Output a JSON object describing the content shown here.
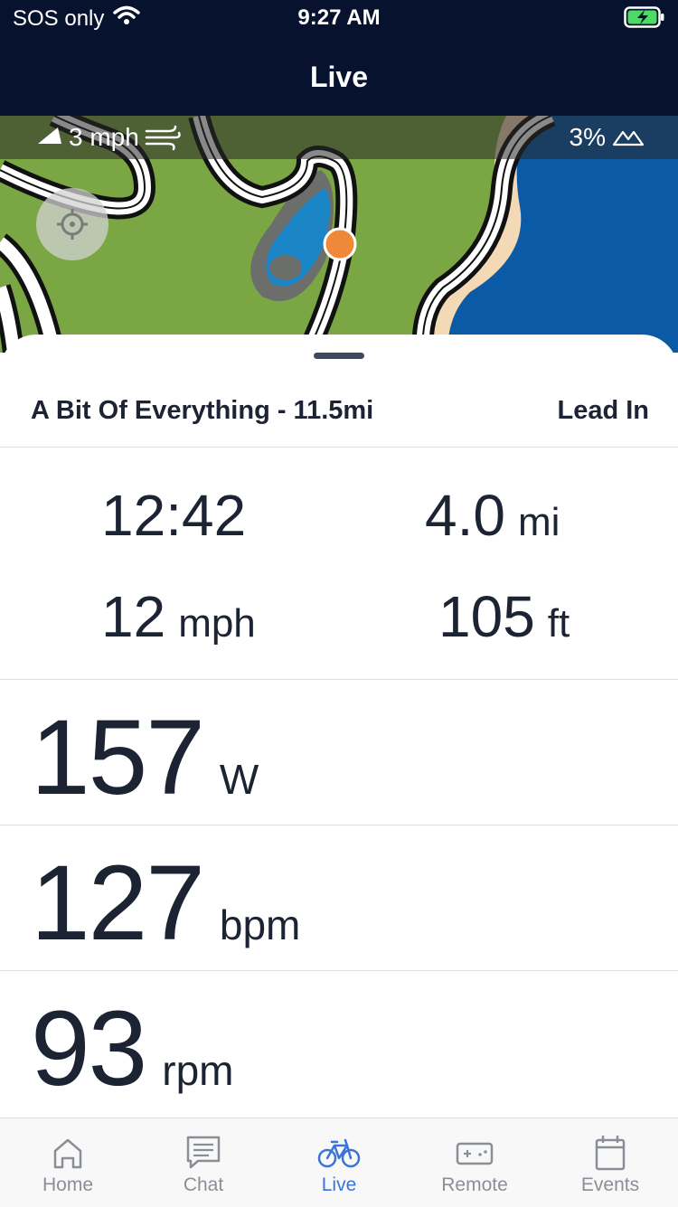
{
  "status_bar": {
    "carrier": "SOS only",
    "time": "9:27 AM"
  },
  "header": {
    "title": "Live"
  },
  "map": {
    "wind": "3 mph",
    "grade": "3%"
  },
  "route": {
    "name": "A Bit Of Everything - 11.5mi",
    "segment": "Lead In"
  },
  "stats": {
    "time": {
      "value": "12:42"
    },
    "distance": {
      "value": "4.0",
      "unit": "mi"
    },
    "speed": {
      "value": "12",
      "unit": "mph"
    },
    "elevation": {
      "value": "105",
      "unit": "ft"
    }
  },
  "metrics": {
    "power": {
      "value": "157",
      "unit": "W"
    },
    "heart_rate": {
      "value": "127",
      "unit": "bpm"
    },
    "cadence": {
      "value": "93",
      "unit": "rpm"
    }
  },
  "tabs": [
    {
      "label": "Home",
      "icon": "home-icon"
    },
    {
      "label": "Chat",
      "icon": "chat-icon"
    },
    {
      "label": "Live",
      "icon": "bike-icon"
    },
    {
      "label": "Remote",
      "icon": "gamepad-icon"
    },
    {
      "label": "Events",
      "icon": "calendar-icon"
    }
  ],
  "colors": {
    "header_bg": "#06122e",
    "active_tab": "#3b74d6",
    "inactive_tab": "#8a8e96",
    "rider_marker": "#f0883a",
    "map_grass": "#7aa744",
    "map_water": "#0a5aa6"
  }
}
